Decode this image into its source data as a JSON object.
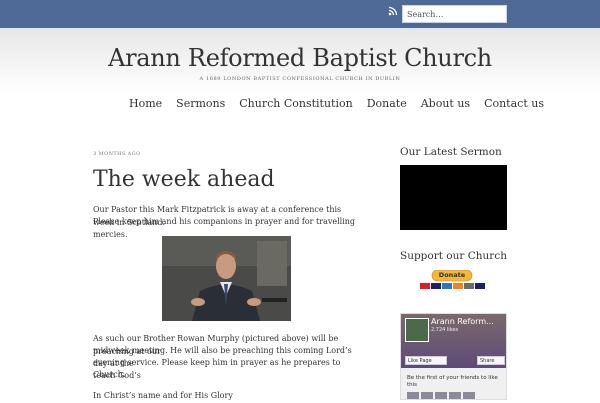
{
  "search": {
    "placeholder": "Search…"
  },
  "site": {
    "title": "Arann Reformed Baptist Church",
    "tagline": "A 1689 LONDON BAPTIST CONFESSIONAL CHURCH IN DUBLIN"
  },
  "nav": [
    "Home",
    "Sermons",
    "Church Constitution",
    "Donate",
    "About us",
    "Contact us"
  ],
  "post": {
    "meta": "3 MONTHS AGO",
    "title": "The week ahead",
    "p1a": "Our Pastor this Mark Fitzpatrick is away at a conference this week in Scotland.",
    "p1b": " Please keep him and his companions in prayer and for travelling mercies.",
    "p2a": "As such our Brother Rowan Murphy (pictured above) will be preaching at our",
    "p2b": "midweek meeting. He will also be preaching this coming Lord’s day at the",
    "p2c": "evening service. Please keep him in prayer as he prepares to teach God’s",
    "p2d": "Church.",
    "p3": "In Christ’s name and for His Glory"
  },
  "sidebar": {
    "sermon_heading": "Our Latest Sermon",
    "support_heading": "Support our Church",
    "donate_label": "Donate",
    "fb": {
      "name": "Arann Reform...",
      "likes": "2,724 likes",
      "like_label": "Like Page",
      "share_label": "Share",
      "friends_text": "Be the first of your friends to like this"
    }
  },
  "colors": {
    "topbar": "#4f6a96",
    "donate": "#f7b532"
  }
}
